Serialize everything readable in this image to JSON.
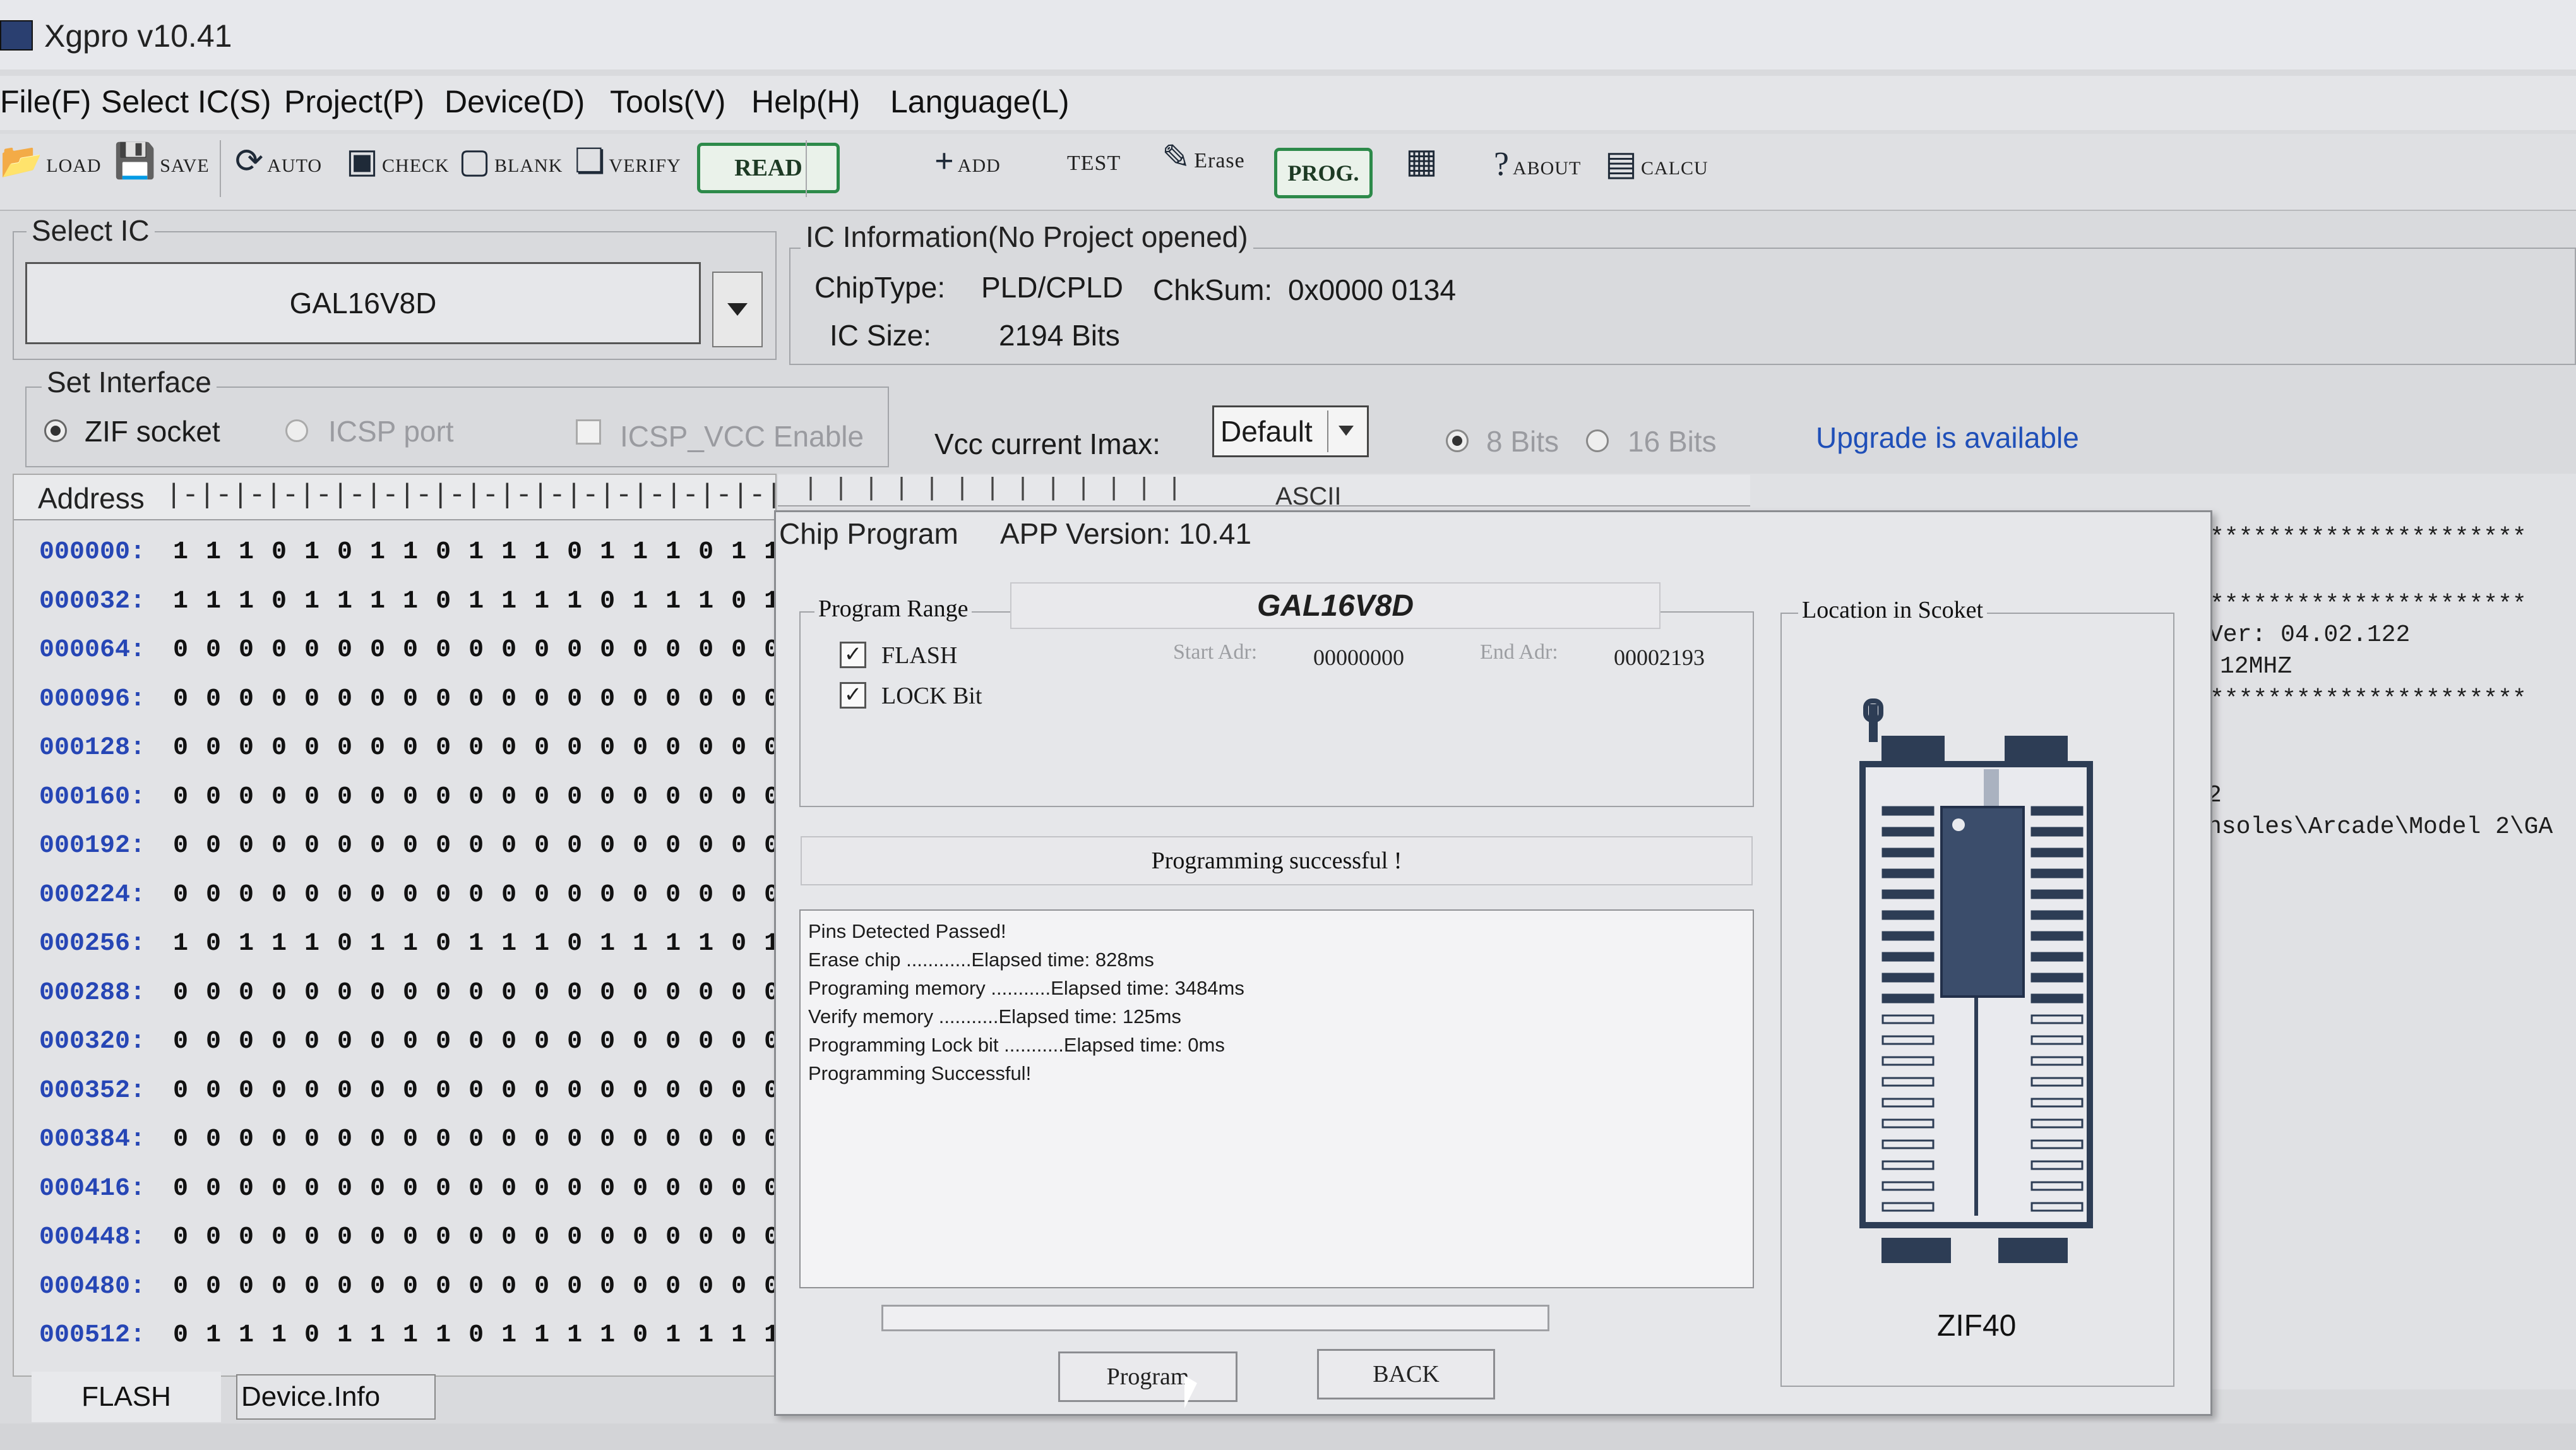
{
  "window": {
    "title": "Xgpro v10.41"
  },
  "menu": [
    "File(F)",
    "Select IC(S)",
    "Project(P)",
    "Device(D)",
    "Tools(V)",
    "Help(H)",
    "Language(L)"
  ],
  "toolbar": {
    "load": "LOAD",
    "save": "SAVE",
    "auto": "AUTO",
    "check": "CHECK",
    "blank": "BLANK",
    "verify": "VERIFY",
    "read": "READ",
    "add": "ADD",
    "test": "TEST",
    "erase": "Erase",
    "prog": "PROG.",
    "about": "ABOUT",
    "calcu": "CALCU"
  },
  "select_ic": {
    "title": "Select IC",
    "value": "GAL16V8D"
  },
  "ic_info": {
    "title": "IC Information(No Project opened)",
    "chip_type_label": "ChipType:",
    "chip_type": "PLD/CPLD",
    "chksum_label": "ChkSum:",
    "chksum": "0x0000 0134",
    "size_label": "IC Size:",
    "size": "2194 Bits"
  },
  "interface": {
    "title": "Set Interface",
    "zif": "ZIF socket",
    "icsp": "ICSP port",
    "icsp_vcc": "ICSP_VCC Enable",
    "vcc_label": "Vcc current Imax:",
    "vcc_value": "Default",
    "bits8": "8 Bits",
    "bits16": "16 Bits",
    "upgrade": "Upgrade is available"
  },
  "grid": {
    "address_header": "Address",
    "ascii_header": "ASCII",
    "rows": [
      {
        "addr": "000000:",
        "bits": "1 1 1 0 1 0 1 1 0 1 1 1 0 1 1 1 0 1 1"
      },
      {
        "addr": "000032:",
        "bits": "1 1 1 0 1 1 1 1 0 1 1 1 1 0 1 1 1 0 1"
      },
      {
        "addr": "000064:",
        "bits": "0 0 0 0 0 0 0 0 0 0 0 0 0 0 0 0 0 0 0"
      },
      {
        "addr": "000096:",
        "bits": "0 0 0 0 0 0 0 0 0 0 0 0 0 0 0 0 0 0 0"
      },
      {
        "addr": "000128:",
        "bits": "0 0 0 0 0 0 0 0 0 0 0 0 0 0 0 0 0 0 0"
      },
      {
        "addr": "000160:",
        "bits": "0 0 0 0 0 0 0 0 0 0 0 0 0 0 0 0 0 0 0"
      },
      {
        "addr": "000192:",
        "bits": "0 0 0 0 0 0 0 0 0 0 0 0 0 0 0 0 0 0 0"
      },
      {
        "addr": "000224:",
        "bits": "0 0 0 0 0 0 0 0 0 0 0 0 0 0 0 0 0 0 0"
      },
      {
        "addr": "000256:",
        "bits": "1 0 1 1 1 0 1 1 0 1 1 1 0 1 1 1 1 0 1"
      },
      {
        "addr": "000288:",
        "bits": "0 0 0 0 0 0 0 0 0 0 0 0 0 0 0 0 0 0 0"
      },
      {
        "addr": "000320:",
        "bits": "0 0 0 0 0 0 0 0 0 0 0 0 0 0 0 0 0 0 0"
      },
      {
        "addr": "000352:",
        "bits": "0 0 0 0 0 0 0 0 0 0 0 0 0 0 0 0 0 0 0"
      },
      {
        "addr": "000384:",
        "bits": "0 0 0 0 0 0 0 0 0 0 0 0 0 0 0 0 0 0 0"
      },
      {
        "addr": "000416:",
        "bits": "0 0 0 0 0 0 0 0 0 0 0 0 0 0 0 0 0 0 0"
      },
      {
        "addr": "000448:",
        "bits": "0 0 0 0 0 0 0 0 0 0 0 0 0 0 0 0 0 0 0"
      },
      {
        "addr": "000480:",
        "bits": "0 0 0 0 0 0 0 0 0 0 0 0 0 0 0 0 0 0 0"
      },
      {
        "addr": "000512:",
        "bits": "0 1 1 1 0 1 1 1 1 0 1 1 1 1 0 1 1 1 1"
      }
    ]
  },
  "right_log": {
    "stars": "**********************",
    "ver": "Ver: 04.02.122",
    "freq": "12MHZ",
    "num": "2",
    "path": "nsoles\\Arcade\\Model 2\\GA"
  },
  "dialog": {
    "title": "Chip Program",
    "version": "APP Version: 10.41",
    "range_title": "Program Range",
    "chip_name": "GAL16V8D",
    "flash": "FLASH",
    "lock": "LOCK Bit",
    "start_label": "Start Adr:",
    "start": "00000000",
    "end_label": "End Adr:",
    "end": "00002193",
    "status": "Programming successful !",
    "log": [
      "Pins Detected Passed!",
      "Erase chip ............Elapsed time: 828ms",
      "Programing memory ...........Elapsed time: 3484ms",
      "Verify memory ...........Elapsed time: 125ms",
      "Programming Lock bit ...........Elapsed time: 0ms",
      "Programming Successful!"
    ],
    "progress": 0,
    "program_button": "Program",
    "back_button": "BACK",
    "location_title": "Location in Scoket",
    "socket_label": "ZIF40"
  },
  "tabs": {
    "flash": "FLASH",
    "device_info": "Device.Info"
  }
}
